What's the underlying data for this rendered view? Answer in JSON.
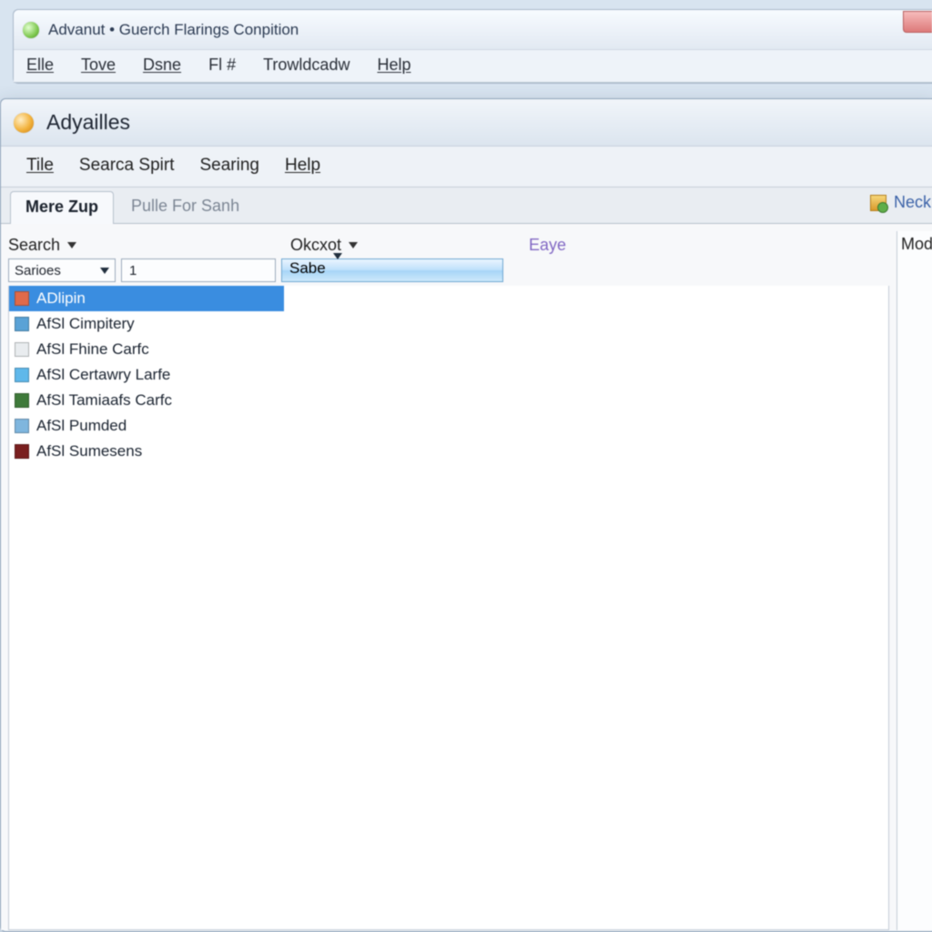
{
  "outer": {
    "title": "Advanut • Guerch Flarings Conpition",
    "menu": [
      "Elle",
      "Tove",
      "Dsne",
      "Fl  #",
      "Trowldcadw",
      "Help"
    ]
  },
  "inner": {
    "title": "Adyailles",
    "menu": [
      "Tile",
      "Searca Spirt",
      "Searing",
      "Help"
    ],
    "tabs": {
      "active": "Mere Zup",
      "inactive": "Pulle For Sanh",
      "right_label": "Neck"
    },
    "filters": {
      "hd_search": "Search",
      "hd_okoot": "Okcxot",
      "hd_eaye": "Eaye",
      "sarioes_label": "Sarioes",
      "num_value": "1",
      "okoot_value": "Sabe"
    },
    "side_header": "Mod",
    "list": [
      {
        "label": "ADlipin",
        "icon_color": "#e06a4a",
        "selected": true
      },
      {
        "label": "AfSl Cimpitery",
        "icon_color": "#5aa2d6",
        "selected": false
      },
      {
        "label": "AfSl Fhine Carfc",
        "icon_color": "#e9ecef",
        "selected": false
      },
      {
        "label": "AfSl Certawry Larfe",
        "icon_color": "#5fb8ea",
        "selected": false
      },
      {
        "label": "AfSl Tamiaafs Carfc",
        "icon_color": "#3f7a3a",
        "selected": false
      },
      {
        "label": "AfSl Pumded",
        "icon_color": "#7fb6de",
        "selected": false
      },
      {
        "label": "AfSl Sumesens",
        "icon_color": "#7a1f1f",
        "selected": false
      }
    ]
  }
}
